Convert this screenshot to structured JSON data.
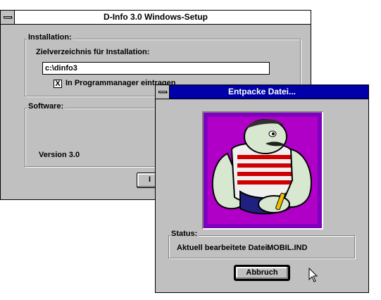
{
  "setup_window": {
    "title": "D-Info 3.0 Windows-Setup",
    "installation_group_label": "Installation:",
    "target_dir_label": "Zielverzeichnis für Installation:",
    "target_dir_value": "c:\\dinfo3",
    "progman_checkbox_label": "In Programmanager eintragen",
    "progman_checked": true,
    "progman_check_glyph": "X",
    "software_group_label": "Software:",
    "version_text": "Version 3.0",
    "button_partial_label": "I"
  },
  "unpack_window": {
    "title": "Entpacke Datei...",
    "mascot_image_icon": "cartoon-strongman-mascot",
    "status_group_label": "Status:",
    "current_file_label": "Aktuell bearbeitete Datei:",
    "current_file_value": "MOBIL.IND",
    "cancel_button_label": "Abbruch"
  },
  "colors": {
    "window_face": "#c0c0c0",
    "active_title": "#0000a8",
    "inactive_title": "#ffffff",
    "mascot_background": "#8000c0"
  }
}
